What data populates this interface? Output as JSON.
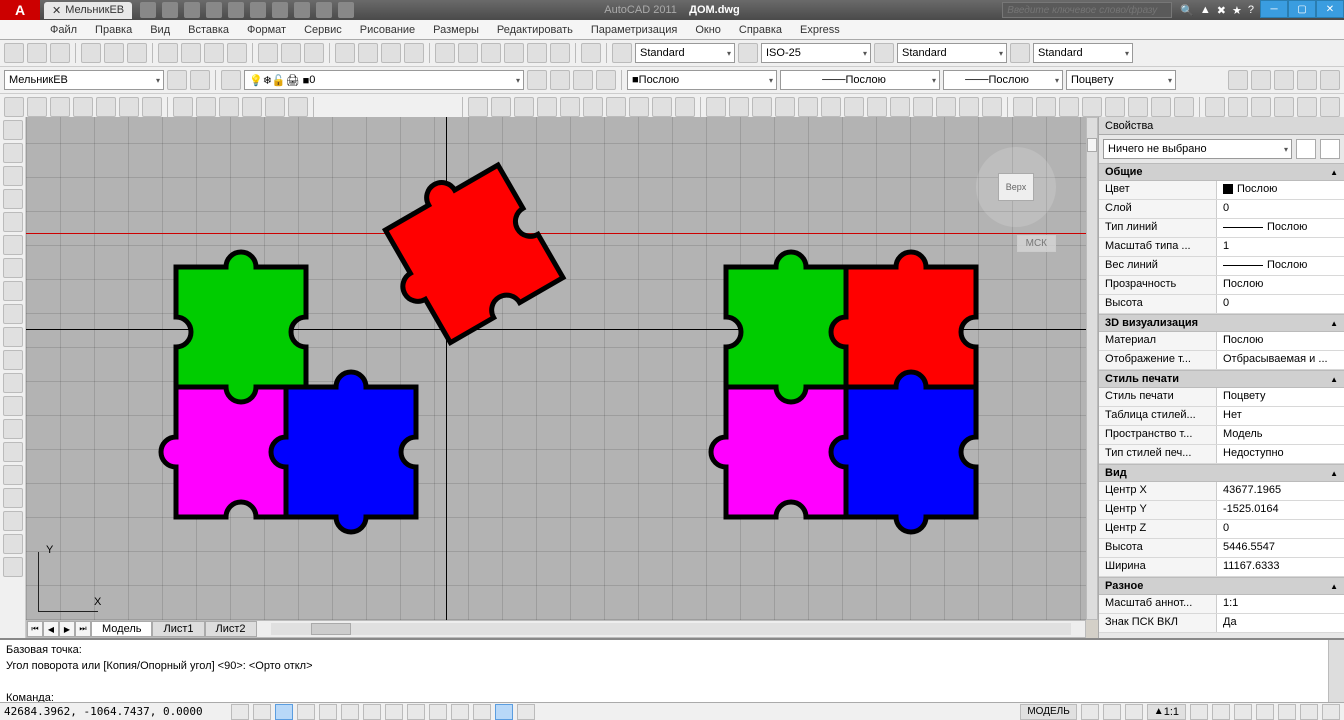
{
  "title": {
    "app": "AutoCAD 2011",
    "file": "ДОМ.dwg",
    "tab": "МельникЕВ"
  },
  "search_placeholder": "Введите ключевое слово/фразу",
  "menu": [
    "Файл",
    "Правка",
    "Вид",
    "Вставка",
    "Формат",
    "Сервис",
    "Рисование",
    "Размеры",
    "Редактировать",
    "Параметризация",
    "Окно",
    "Справка",
    "Express"
  ],
  "styles": {
    "text": "Standard",
    "dim": "ISO-25",
    "table": "Standard",
    "ml": "Standard"
  },
  "layer": {
    "user": "МельникЕВ",
    "current": "0",
    "bylayer": "Послою",
    "bycolor": "Поцвету"
  },
  "tabs": {
    "model": "Модель",
    "sheet1": "Лист1",
    "sheet2": "Лист2"
  },
  "viewcube": {
    "top": "Верх",
    "sys": "МСК"
  },
  "axis": {
    "x": "X",
    "y": "Y"
  },
  "props": {
    "title": "Свойства",
    "selection": "Ничего не выбрано",
    "groups": {
      "general": "Общие",
      "viz3d": "3D визуализация",
      "plot": "Стиль печати",
      "view": "Вид",
      "misc": "Разное"
    },
    "general": {
      "color_k": "Цвет",
      "color_v": "Послою",
      "layer_k": "Слой",
      "layer_v": "0",
      "lt_k": "Тип линий",
      "lt_v": "Послою",
      "lts_k": "Масштаб типа ...",
      "lts_v": "1",
      "lw_k": "Вес линий",
      "lw_v": "Послою",
      "tr_k": "Прозрачность",
      "tr_v": "Послою",
      "h_k": "Высота",
      "h_v": "0"
    },
    "viz3d": {
      "mat_k": "Материал",
      "mat_v": "Послою",
      "sh_k": "Отображение т...",
      "sh_v": "Отбрасываемая и ..."
    },
    "plot": {
      "ps_k": "Стиль печати",
      "ps_v": "Поцвету",
      "pst_k": "Таблица стилей...",
      "pst_v": "Нет",
      "psp_k": "Пространство т...",
      "psp_v": "Модель",
      "pty_k": "Тип стилей печ...",
      "pty_v": "Недоступно"
    },
    "view": {
      "cx_k": "Центр X",
      "cx_v": "43677.1965",
      "cy_k": "Центр Y",
      "cy_v": "-1525.0164",
      "cz_k": "Центр Z",
      "cz_v": "0",
      "vh_k": "Высота",
      "vh_v": "5446.5547",
      "vw_k": "Ширина",
      "vw_v": "11167.6333"
    },
    "misc": {
      "as_k": "Масштаб аннот...",
      "as_v": "1:1",
      "uc_k": "Знак ПСК ВКЛ",
      "uc_v": "Да"
    }
  },
  "cmd": {
    "l1": "Базовая точка:",
    "l2": "Угол поворота или [Копия/Опорный угол] <90>:  <Орто откл>",
    "l3": "Команда:"
  },
  "status": {
    "coords": "42684.3962, -1064.7437, 0.0000",
    "model": "МОДЕЛЬ",
    "scale": "1:1"
  }
}
